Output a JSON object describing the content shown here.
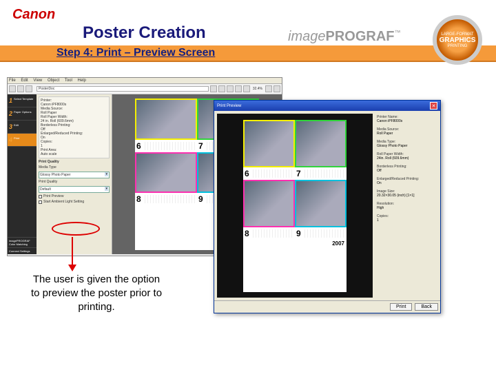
{
  "logo": "Canon",
  "title": "Poster Creation",
  "subtitle": "Step 4: Print – Preview Screen",
  "brand": {
    "a": "image",
    "b": "PROGRAF",
    "tm": "™"
  },
  "badge": {
    "top": "LARGE-FORMAT",
    "mid": "GRAPHICS",
    "bot": "PRINTING"
  },
  "menu": [
    "File",
    "Edit",
    "View",
    "Object",
    "Tool",
    "Help"
  ],
  "toolbar_doc": "PosterDoc",
  "zoom": "32.4%",
  "steps": [
    {
      "num": "1",
      "label": "Select Template"
    },
    {
      "num": "2",
      "label": "Paper Options"
    },
    {
      "num": "3",
      "label": "Edit"
    },
    {
      "num": "4",
      "label": "Print"
    }
  ],
  "panel_summary": [
    "Printer:",
    "Canon iPF8000s",
    "",
    "Media Source:",
    "Roll Paper",
    "",
    "Roll Paper Width:",
    "24 in. Roll (609.6mm)",
    "Borderless Printing:",
    "Off",
    "",
    "Enlarged/Reduced Printing:",
    "On",
    "",
    "Copies:",
    "1",
    "",
    "Print Area:",
    "Auto scale"
  ],
  "panel": {
    "quality_h": "Print Quality",
    "media": "Media Type",
    "media_v": "Glossy Photo Paper",
    "quality": "Print Quality",
    "quality_v": "Default",
    "chk1": "Print Preview",
    "chk2": "Start Ambient Light Setting"
  },
  "cells": [
    {
      "n": "6",
      "c": "c6"
    },
    {
      "n": "7",
      "c": "c7"
    },
    {
      "n": "8",
      "c": "c8"
    },
    {
      "n": "9",
      "c": "c9"
    }
  ],
  "year": "2007",
  "caption": "The user is given the option to preview the poster prior to printing.",
  "preview": {
    "title": "Print Preview",
    "info": [
      {
        "k": "Printer Name:",
        "v": "Canon iPF8000s"
      },
      {
        "k": "Media Source:",
        "v": "Roll Paper"
      },
      {
        "k": "Media Type:",
        "v": "Glossy Photo Paper"
      },
      {
        "k": "Roll Paper Width:",
        "v": "24in. Roll (609.6mm)"
      },
      {
        "k": "Borderless Printing:",
        "v": "Off"
      },
      {
        "k": "Enlarged/Reduced Printing:",
        "v": "On"
      },
      {
        "k": "Image Size:",
        "v": "20.32×30.05 (inch) [1×1]"
      },
      {
        "k": "Resolution:",
        "v": "High"
      },
      {
        "k": "Copies:",
        "v": "1"
      }
    ],
    "print": "Print",
    "back": "Back"
  }
}
